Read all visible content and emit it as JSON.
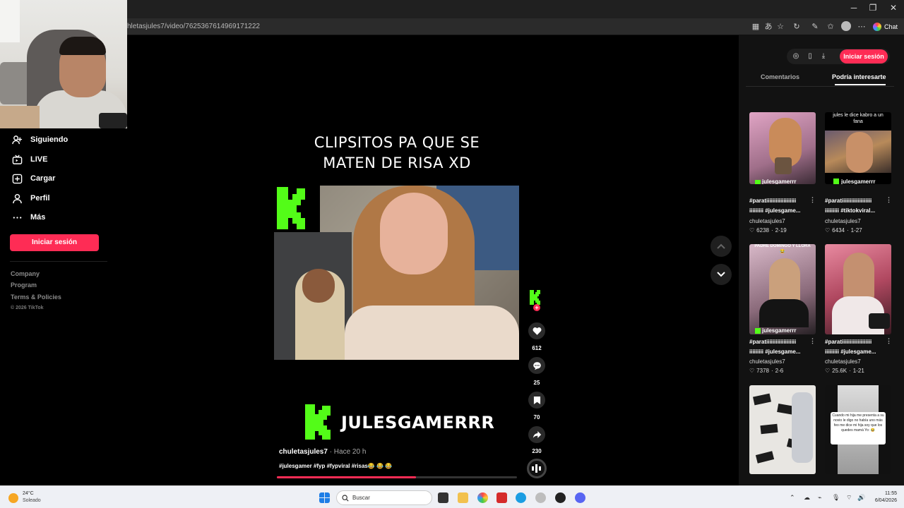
{
  "browser": {
    "url": "hletasjules7/video/7625367614969171222",
    "chat_label": "Chat"
  },
  "sidebar": {
    "items": [
      {
        "label": "Siguiendo",
        "icon": "following-icon"
      },
      {
        "label": "LIVE",
        "icon": "live-tv-icon"
      },
      {
        "label": "Cargar",
        "icon": "upload-icon"
      },
      {
        "label": "Perfil",
        "icon": "profile-icon"
      },
      {
        "label": "Más",
        "icon": "more-dots-icon"
      }
    ],
    "login_label": "Iniciar sesión",
    "footer_links": [
      "Company",
      "Program",
      "Terms & Policies"
    ],
    "copyright": "© 2026 TikTok"
  },
  "video": {
    "title_line1": "CLIPSITOS PA QUE SE",
    "title_line2": "MATEN DE RISA XD",
    "channel_name": "JULESGAMERRR",
    "author": "chuletasjules7",
    "posted": "· Hace 20 h",
    "caption": "#julesgamer #fyp #fypviral #risas😂 😂 😂",
    "progress": 0.58,
    "likes": "612",
    "comments": "25",
    "saves": "70",
    "shares": "230"
  },
  "right_panel": {
    "login_label": "Iniciar sesión",
    "tab_comments": "Comentarios",
    "tab_recommended": "Podría interesarte",
    "cards": [
      {
        "overlay": "",
        "watermark": "julesgamerrr",
        "title_line1": "#paratiiiiiiiiiiiiiiiiiii",
        "title_line2": "iiiiiiiii #julesgame...",
        "user": "chuletasjules7",
        "likes": "6238",
        "date": "2-19"
      },
      {
        "overlay": "jules le dice kabro a un fana",
        "watermark": "julesgamerrr",
        "title_line1": "#paratiiiiiiiiiiiiiiiiiii",
        "title_line2": "iiiiiiiii #tiktokviral...",
        "user": "chuletasjules7",
        "likes": "6434",
        "date": "1-27"
      },
      {
        "overlay": "PADRE DOMINGO Y LLORA😂",
        "watermark": "julesgamerrr",
        "title_line1": "#paratiiiiiiiiiiiiiiiiiii",
        "title_line2": "iiiiiiiii #julesgame...",
        "user": "chuletasjules7",
        "likes": "7378",
        "date": "2-6"
      },
      {
        "overlay": "",
        "watermark": "",
        "title_line1": "#paratiiiiiiiiiiiiiiiiiii",
        "title_line2": "iiiiiiiii #julesgame...",
        "user": "chuletasjules7",
        "likes": "25.6K",
        "date": "1-21"
      },
      {
        "overlay": "",
        "watermark": "",
        "title_line1": "",
        "title_line2": "",
        "user": "",
        "likes": "",
        "date": ""
      },
      {
        "overlay": "Cuando mi hija me presenta a su novio le digo no había uno más feo me dice mi hija soy que los quedes mamá Yo: 😂",
        "watermark": "",
        "title_line1": "",
        "title_line2": "",
        "user": "",
        "likes": "",
        "date": ""
      }
    ]
  },
  "taskbar": {
    "temperature": "24°C",
    "weather": "Soleado",
    "search_placeholder": "Buscar",
    "time": "11:55",
    "date": "6/04/2026"
  },
  "colors": {
    "brand_pink": "#fe2c55",
    "kick_green": "#53fc18"
  }
}
